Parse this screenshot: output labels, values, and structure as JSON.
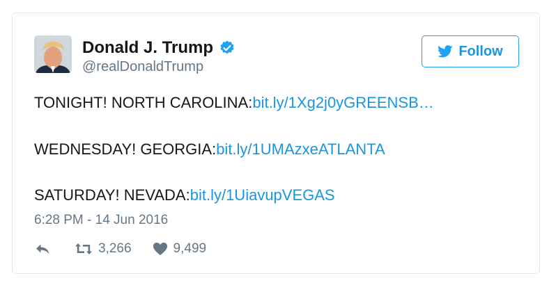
{
  "author": {
    "name": "Donald J. Trump",
    "handle": "@realDonaldTrump",
    "verified": true,
    "avatar": "profile-photo"
  },
  "follow_button": {
    "label": "Follow",
    "icon": "twitter-bird-icon"
  },
  "tweet": {
    "lines": [
      {
        "text": "TONIGHT! NORTH CAROLINA:",
        "link": "bit.ly/1Xg2j0yGREENSB…"
      },
      {
        "text": "WEDNESDAY! GEORGIA:",
        "link": "bit.ly/1UMAzxeATLANTA"
      },
      {
        "text": "SATURDAY! NEVADA:",
        "link": "bit.ly/1UiavupVEGAS"
      }
    ],
    "timestamp": "6:28 PM - 14 Jun 2016"
  },
  "actions": {
    "reply": {
      "icon": "reply-icon"
    },
    "retweet": {
      "icon": "retweet-icon",
      "count": "3,266"
    },
    "like": {
      "icon": "heart-icon",
      "count": "9,499"
    }
  },
  "colors": {
    "link": "#1b95e0",
    "verified": "#1da1f2",
    "muted": "#657786",
    "border": "#e1e8ed"
  }
}
